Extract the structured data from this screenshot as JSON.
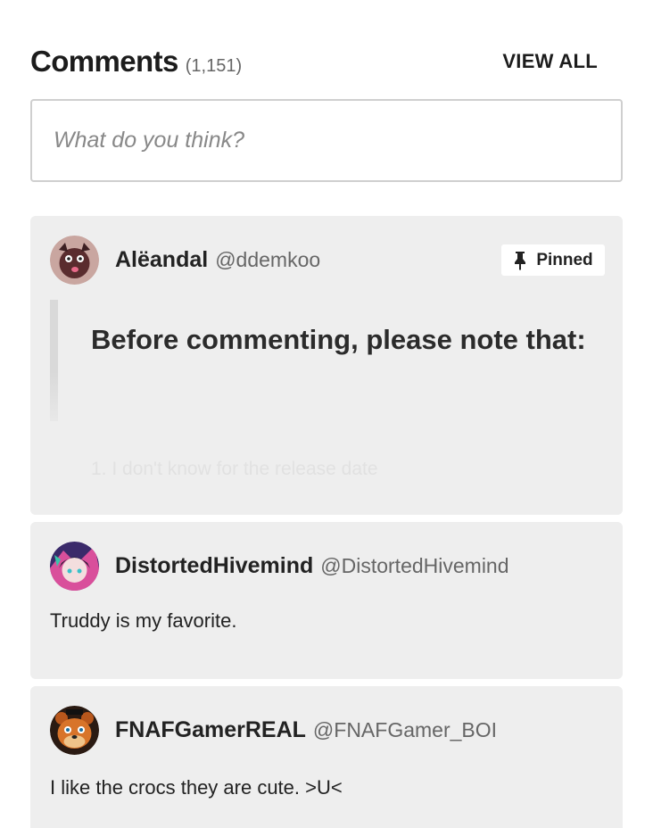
{
  "header": {
    "title": "Comments",
    "count": "(1,151)",
    "view_all_label": "VIEW ALL"
  },
  "input": {
    "placeholder": "What do you think?"
  },
  "comments": [
    {
      "author": "Alëandal",
      "handle": "@ddemkoo",
      "pinned_label": "Pinned",
      "quote_text": "Before commenting, please note that:",
      "faded_text": "1. I don't know for the release date",
      "avatar_icon": "avatar-icon"
    },
    {
      "author": "DistortedHivemind",
      "handle": "@DistortedHivemind",
      "text": "Truddy is my favorite.",
      "avatar_icon": "avatar-icon"
    },
    {
      "author": "FNAFGamerREAL",
      "handle": "@FNAFGamer_BOI",
      "text": "I like the crocs they are cute. >U<",
      "avatar_icon": "avatar-icon"
    }
  ],
  "colors": {
    "card_background": "#eeeeee",
    "input_border": "#cfcfcf",
    "text_primary": "#222222",
    "text_muted": "#666666"
  }
}
